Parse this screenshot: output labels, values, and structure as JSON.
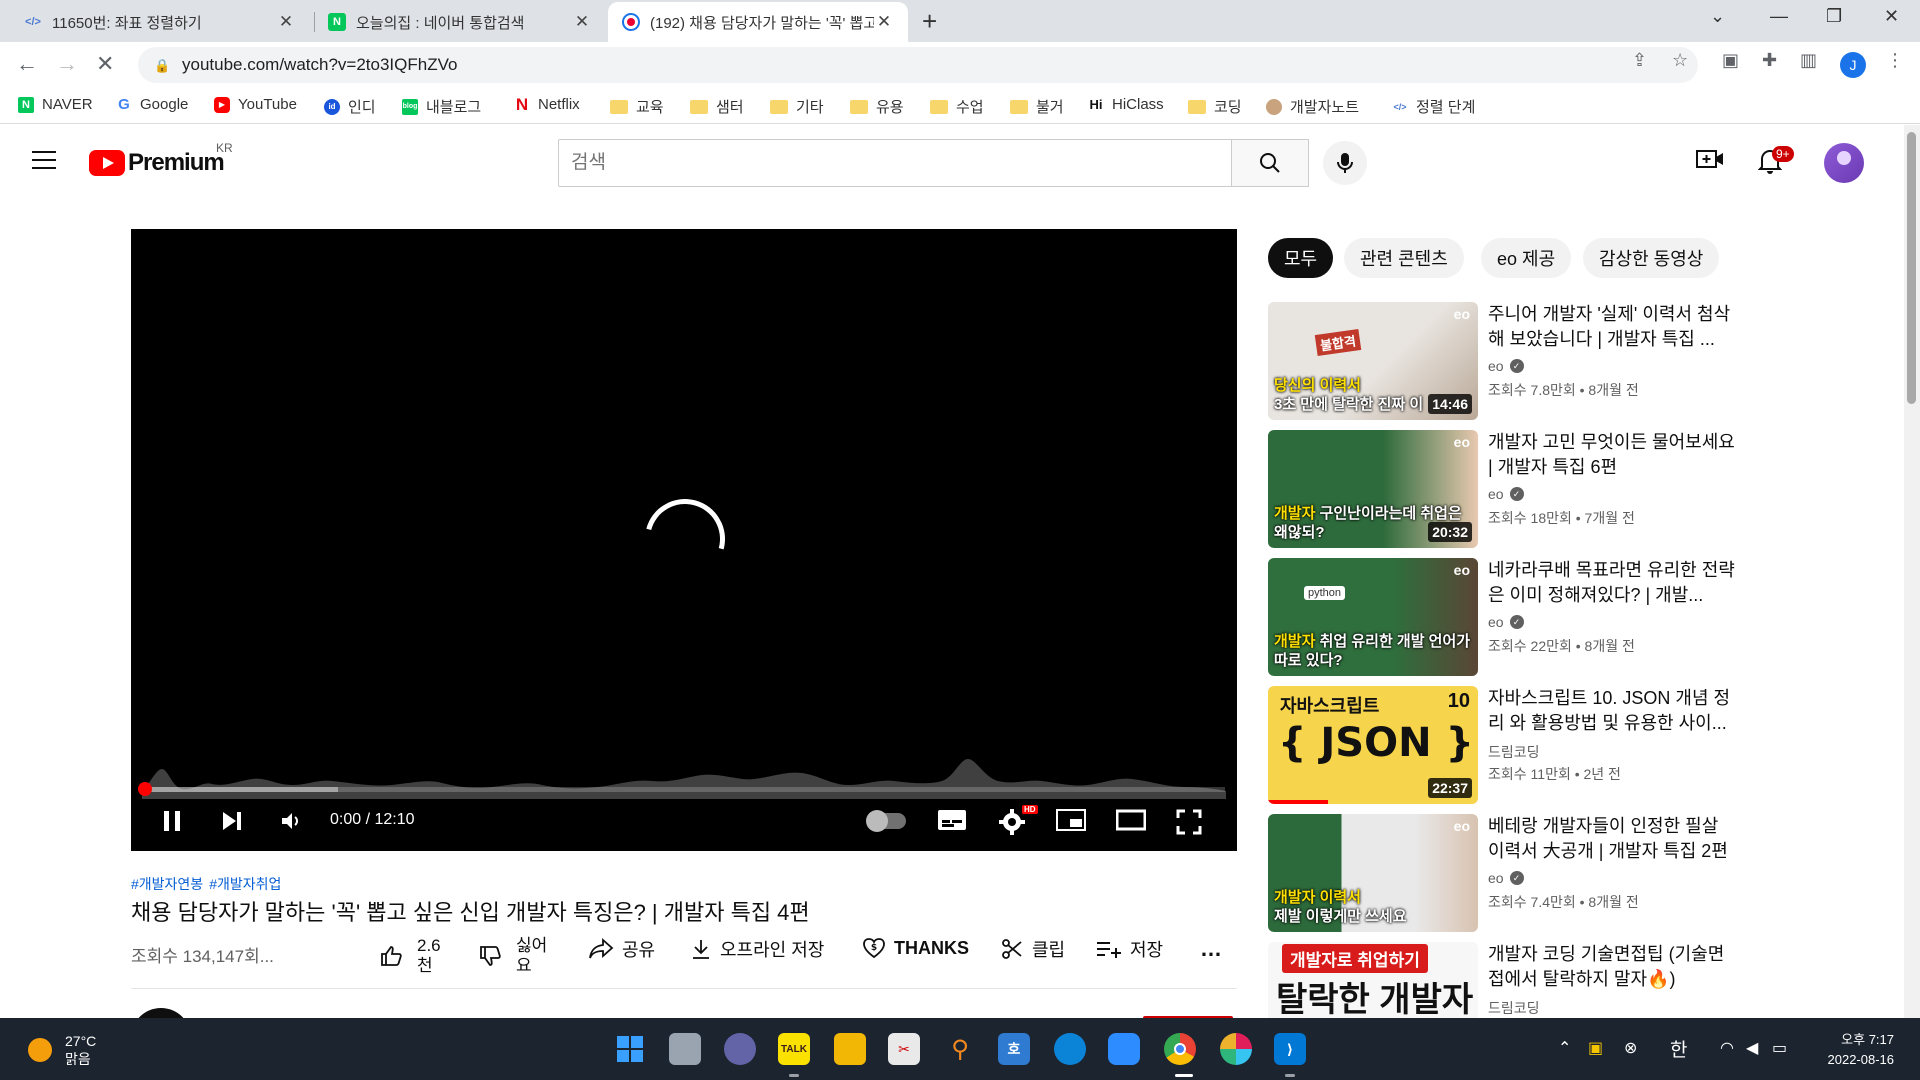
{
  "browser": {
    "tabs": [
      {
        "title": "11650번: 좌표 정렬하기",
        "active": false
      },
      {
        "title": "오늘의집 : 네이버 통합검색",
        "active": false
      },
      {
        "title": "(192) 채용 담당자가 말하는 '꼭' 뽑고 싶은",
        "active": true
      }
    ],
    "url": "youtube.com/watch?v=2to3IQFhZVo",
    "profile_initial": "J",
    "bookmarks": [
      {
        "label": "NAVER",
        "icon": "naver-icon"
      },
      {
        "label": "Google",
        "icon": "google-icon"
      },
      {
        "label": "YouTube",
        "icon": "youtube-icon"
      },
      {
        "label": "인디",
        "icon": "indi-icon"
      },
      {
        "label": "내블로그",
        "icon": "blog-icon"
      },
      {
        "label": "Netflix",
        "icon": "netflix-icon"
      },
      {
        "label": "교육",
        "icon": "folder-icon"
      },
      {
        "label": "샘터",
        "icon": "folder-icon"
      },
      {
        "label": "기타",
        "icon": "folder-icon"
      },
      {
        "label": "유용",
        "icon": "folder-icon"
      },
      {
        "label": "수업",
        "icon": "folder-icon"
      },
      {
        "label": "불거",
        "icon": "folder-icon"
      },
      {
        "label": "HiClass",
        "icon": "hiclass-icon"
      },
      {
        "label": "코딩",
        "icon": "folder-icon"
      },
      {
        "label": "개발자노트",
        "icon": "dev-note-icon"
      },
      {
        "label": "정렬 단계",
        "icon": "code-icon"
      }
    ]
  },
  "youtube": {
    "logo_word": "Premium",
    "logo_region": "KR",
    "search_placeholder": "검색",
    "notification_badge": "9+"
  },
  "player": {
    "time": "0:00 / 12:10",
    "hd_badge": "HD",
    "progress_buffered": 0.18
  },
  "video": {
    "hashtags": [
      "#개발자연봉",
      "#개발자취업"
    ],
    "title": "채용 담당자가 말하는 '꼭' 뽑고 싶은 신입 개발자 특징은? | 개발자 특집 4편",
    "views": "조회수 134,147회...",
    "likes_line1": "2.6",
    "likes_line2": "천",
    "dislike_line1": "싫어",
    "dislike_line2": "요",
    "share": "공유",
    "download": "오프라인 저장",
    "thanks": "THANKS",
    "clip": "클립",
    "save": "저장",
    "more": "…"
  },
  "chips": [
    "모두",
    "관련 콘텐츠",
    "eo 제공",
    "감상한 동영상"
  ],
  "recommendations": [
    {
      "title": "주니어 개발자 '실제' 이력서 첨삭해 보았습니다 | 개발자 특집 ...",
      "channel": "eo",
      "meta": "조회수 7.8만회 • 8개월 전",
      "duration": "14:46",
      "badge": "eo",
      "caption_hl": "당신의 이력서",
      "caption": "3초 만에 탈락한 진짜 이",
      "bg": "#d9d4cf"
    },
    {
      "title": "개발자 고민 무엇이든 물어보세요 | 개발자 특집 6편",
      "channel": "eo",
      "meta": "조회수 18만회 • 7개월 전",
      "duration": "20:32",
      "badge": "eo",
      "caption_hl": "개발자",
      "caption": "구인난이라는데 취업은 왜않되?",
      "bg": "#2e6b3c"
    },
    {
      "title": "네카라쿠배 목표라면 유리한 전략은 이미 정해져있다? | 개발...",
      "channel": "eo",
      "meta": "조회수 22만회 • 8개월 전",
      "duration": "",
      "badge": "eo",
      "caption_hl": "개발자",
      "caption": "취업 유리한 개발 언어가 따로 있다?",
      "bg": "#2f6e3d"
    },
    {
      "title": "자바스크립트 10. JSON 개념 정리 와 활용방법 및 유용한 사이...",
      "channel": "드림코딩",
      "meta": "조회수 11만회 • 2년 전",
      "duration": "22:37",
      "badge": "10",
      "caption_hl": "",
      "caption": "{ JSON }",
      "bg": "#f6d44b"
    },
    {
      "title": "베테랑 개발자들이 인정한 필살 이력서 大공개 | 개발자 특집 2편",
      "channel": "eo",
      "meta": "조회수 7.4만회 • 8개월 전",
      "duration": "",
      "badge": "eo",
      "caption_hl": "개발자 이력서",
      "caption": "제발 이렇게만 쓰세요",
      "bg": "#2d6a3b"
    },
    {
      "title": "개발자 코딩 기술면접팁 (기술면접에서 탈락하지 말자🔥)",
      "channel": "드림코딩",
      "meta": "",
      "duration": "",
      "badge": "",
      "caption_hl": "개발자로 취업하기",
      "caption": "탈락한 개발자",
      "bg": "#f7f7f7"
    }
  ],
  "taskbar": {
    "temperature": "27°C",
    "weather": "맑음",
    "ime": "한",
    "time": "오후 7:17",
    "date": "2022-08-16"
  },
  "colors": {
    "youtube_red": "#ff0000",
    "link_blue": "#065fd4",
    "taskbar": "#1c2430"
  }
}
